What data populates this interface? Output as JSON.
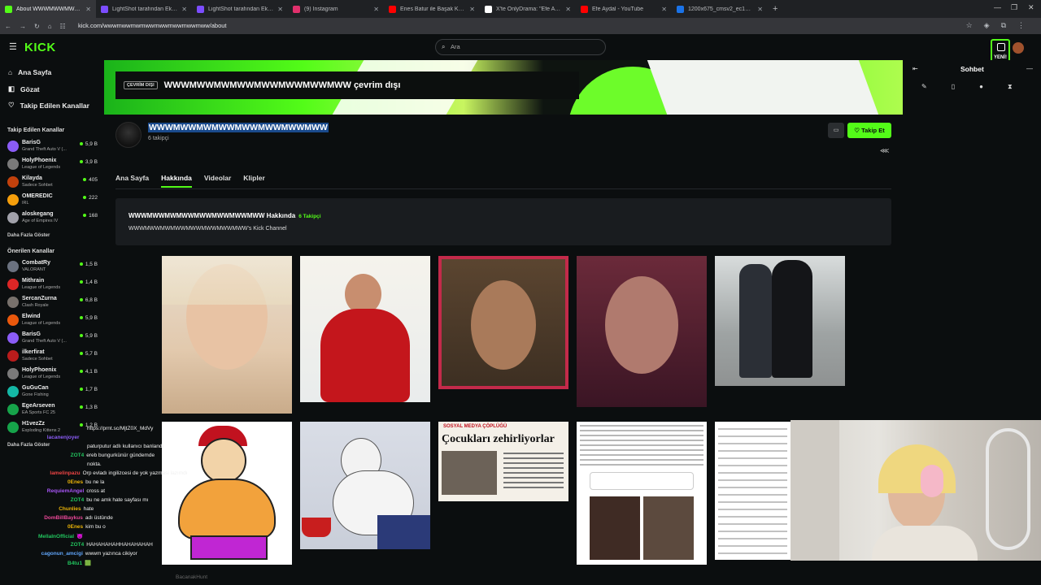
{
  "browser": {
    "tabs": [
      {
        "title": "About WWWMWWMWWMW",
        "color": "#53fc18",
        "active": true
      },
      {
        "title": "LightShot tarafından Ekran Gör",
        "color": "#7c4dff",
        "active": false
      },
      {
        "title": "LightShot tarafından Ekran Gör",
        "color": "#7c4dff",
        "active": false
      },
      {
        "title": "(9) Instagram",
        "color": "#e1306c",
        "active": false
      },
      {
        "title": "Enes Batur ile Başak Karahan A",
        "color": "#ff0000",
        "active": false
      },
      {
        "title": "X'te OnlyDrama: \"Efe Aydal, Bu",
        "color": "#ffffff",
        "active": false
      },
      {
        "title": "Efe Aydal - YouTube",
        "color": "#ff0000",
        "active": false
      },
      {
        "title": "1200x675_cmsv2_ec180875-7c",
        "color": "#1a73e8",
        "active": false
      }
    ],
    "new_tab": "+",
    "url": "kick.com/wwwmwwmwmwwmwwmwwmwwmww/about"
  },
  "header": {
    "logo": "KICK",
    "search_placeholder": "Ara",
    "new_badge": "YENİ!"
  },
  "sidebar": {
    "nav": [
      {
        "label": "Ana Sayfa",
        "icon": "home-icon",
        "glyph": "⌂"
      },
      {
        "label": "Gözat",
        "icon": "browse-icon",
        "glyph": "◧"
      },
      {
        "label": "Takip Edilen Kanallar",
        "icon": "heart-icon",
        "glyph": "♡"
      }
    ],
    "followed_title": "Takip Edilen Kanallar",
    "followed": [
      {
        "name": "BarisG",
        "game": "Grand Theft Auto V (...",
        "viewers": "5,9 B",
        "color": "#8b5cf6"
      },
      {
        "name": "HolyPhoenix",
        "game": "League of Legends",
        "viewers": "3,9 B",
        "color": "#7a7a7a"
      },
      {
        "name": "Kilayda",
        "game": "Sadece Sohbet",
        "viewers": "405",
        "color": "#c2410c"
      },
      {
        "name": "OMEREDIC",
        "game": "IRL",
        "viewers": "222",
        "color": "#f59e0b"
      },
      {
        "name": "alosk­egang",
        "game": "Age of Empires IV",
        "viewers": "168",
        "color": "#a1a1aa"
      }
    ],
    "followed_more": "Daha Fazla Göster",
    "recommended_title": "Önerilen Kanallar",
    "recommended": [
      {
        "name": "CombatRy",
        "game": "VALORANT",
        "viewers": "1,5 B",
        "color": "#6b7280"
      },
      {
        "name": "Mithrain",
        "game": "League of Legends",
        "viewers": "1,4 B",
        "color": "#dc2626"
      },
      {
        "name": "SercanZurna",
        "game": "Clash Royale",
        "viewers": "6,8 B",
        "color": "#78716c"
      },
      {
        "name": "Elwind",
        "game": "League of Legends",
        "viewers": "5,9 B",
        "color": "#ea580c"
      },
      {
        "name": "BarisG",
        "game": "Grand Theft Auto V (...",
        "viewers": "5,9 B",
        "color": "#8b5cf6"
      },
      {
        "name": "ilkerfirat",
        "game": "Sadece Sohbet",
        "viewers": "5,7 B",
        "color": "#b91c1c"
      },
      {
        "name": "HolyPhoenix",
        "game": "League of Legends",
        "viewers": "4,1 B",
        "color": "#7a7a7a"
      },
      {
        "name": "GuGuCan",
        "game": "Gone Fishing",
        "viewers": "1,7 B",
        "color": "#14b8a6"
      },
      {
        "name": "EgeArseven",
        "game": "EA Sports FC 25",
        "viewers": "1,3 B",
        "color": "#16a34a"
      },
      {
        "name": "H1vezZz",
        "game": "Exploding Kittens 2",
        "viewers": "1,2 B",
        "color": "#16a34a"
      }
    ],
    "recommended_more": "Daha Fazla Göster"
  },
  "channel": {
    "offline_tag": "ÇEVRİM DIŞI",
    "offline_title": "WWWMWWMWMWWMWWMWWMWWMWW çevrim dışı",
    "name": "WWWMWWMWMWWMWWMWWMWWMWW",
    "followers": "6 takipçi",
    "follow_button": "Takip Et",
    "tabs": [
      "Ana Sayfa",
      "Hakkında",
      "Videolar",
      "Klipler"
    ],
    "active_tab": "Hakkında",
    "about_title": "WWWMWWMWMWWMWWMWWMWWMWW Hakkında",
    "about_followers": "6 Takipçi",
    "about_desc": "WWWMWWMWMWWMWWMWWMWWMWW's Kick Channel"
  },
  "newspaper": {
    "header": "SOSYAL MEDYA ÇÖPLÜĞÜ",
    "headline": "Çocukları zehirliyorlar"
  },
  "chat": {
    "title": "Sohbet"
  },
  "overlay_chat": [
    {
      "user": "",
      "msg": "https://prnt.sc/MjtZ0X_MdVy",
      "color": "#ffffff"
    },
    {
      "user": "lacanenjoyer",
      "msg": "",
      "color": "#8b5cf6"
    },
    {
      "user": "",
      "msg": "paturputur adlı kullanıcı banlandı",
      "color": "#ffffff"
    },
    {
      "user": "ZOT4",
      "msg": "ereb bungurkünür gündemde",
      "color": "#22c55e"
    },
    {
      "user": "",
      "msg": "nokta.",
      "color": "#ffffff"
    },
    {
      "user": "lamelinpazu",
      "msg": "Orp evladı ingilizcesi de yok yazmasi lazımdı",
      "color": "#ef4444"
    },
    {
      "user": "0Enes",
      "msg": "bu ne la",
      "color": "#eab308"
    },
    {
      "user": "RequiemAngel",
      "msg": "cross at",
      "color": "#a855f7"
    },
    {
      "user": "ZOT4",
      "msg": "bu ne amk hate sayfası mı",
      "color": "#22c55e"
    },
    {
      "user": "Chunlies",
      "msg": "hate",
      "color": "#eab308"
    },
    {
      "user": "DomBillBaykus",
      "msg": "adı üstünde",
      "color": "#ec4899"
    },
    {
      "user": "0Enes",
      "msg": "kim bu o",
      "color": "#eab308"
    },
    {
      "user": "MellaInOfficial",
      "msg": "😈",
      "color": "#22c55e"
    },
    {
      "user": "ZOT4",
      "msg": "HAHAHAHAHHAHAHAHAH",
      "color": "#22c55e"
    },
    {
      "user": "cagonun_amcigi",
      "msg": "wwwm yazınca cikiyor",
      "color": "#60a5fa"
    },
    {
      "user": "B4tu1",
      "msg": "🟩",
      "color": "#22c55e"
    }
  ],
  "bottom_text": "BacanakHunt"
}
